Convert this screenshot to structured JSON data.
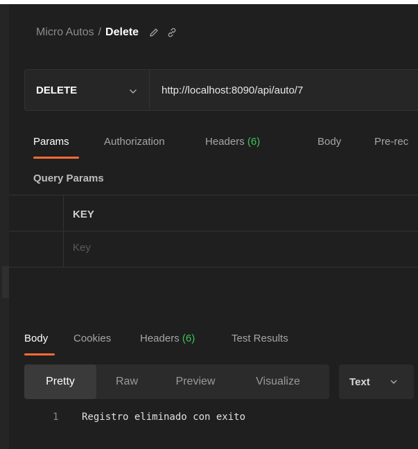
{
  "breadcrumb": {
    "collection": "Micro Autos",
    "separator": "/",
    "request": "Delete"
  },
  "request": {
    "method": "DELETE",
    "url": "http://localhost:8090/api/auto/7"
  },
  "request_tabs": [
    {
      "label": "Params"
    },
    {
      "label": "Authorization"
    },
    {
      "label": "Headers",
      "count": "(6)"
    },
    {
      "label": "Body"
    },
    {
      "label": "Pre-rec"
    }
  ],
  "query_params": {
    "title": "Query Params",
    "key_header": "KEY",
    "key_placeholder": "Key"
  },
  "response_tabs": [
    {
      "label": "Body"
    },
    {
      "label": "Cookies"
    },
    {
      "label": "Headers",
      "count": "(6)"
    },
    {
      "label": "Test Results"
    }
  ],
  "format_tabs": [
    "Pretty",
    "Raw",
    "Preview",
    "Visualize"
  ],
  "format_type": "Text",
  "response_body": {
    "line_number": "1",
    "text": "Registro eliminado con exito"
  },
  "colors": {
    "accent": "#ff6c37",
    "count": "#3ac55a",
    "background": "#1f1f1f"
  }
}
